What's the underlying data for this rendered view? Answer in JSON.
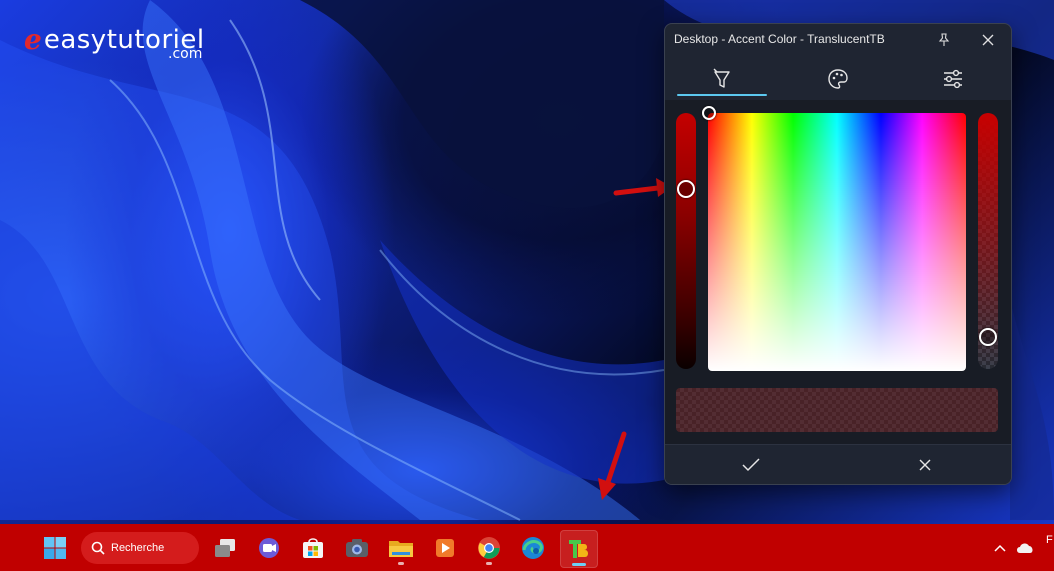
{
  "branding": {
    "logo_mark": "e",
    "logo_text": "easytutoriel",
    "logo_sub": ".com"
  },
  "dialog": {
    "title": "Desktop - Accent Color - TranslucentTB",
    "buttons": {
      "pin": "pin-icon",
      "close": "close-icon"
    },
    "tabs": [
      {
        "icon": "color-picker-icon",
        "selected": true
      },
      {
        "icon": "palette-icon",
        "selected": false
      },
      {
        "icon": "sliders-icon",
        "selected": false
      }
    ],
    "color_picker": {
      "hue_color": "#c40000",
      "alpha_level": 0.12
    },
    "footer": {
      "confirm": "checkmark-icon",
      "cancel": "close-icon"
    }
  },
  "taskbar": {
    "background": "#c00000",
    "search_label": "Recherche",
    "apps": [
      "start-icon",
      "task-view-icon",
      "chat-icon",
      "store-icon",
      "camera-icon",
      "file-explorer-icon",
      "media-player-icon",
      "chrome-icon",
      "edge-icon",
      "translucenttb-icon"
    ],
    "tray": {
      "chevron": "chevron-up-icon",
      "cloud": "onedrive-icon",
      "clock_line1": "F",
      "clock_line2": ""
    }
  },
  "annotations": {
    "arrow_color": "#d20f0f"
  }
}
